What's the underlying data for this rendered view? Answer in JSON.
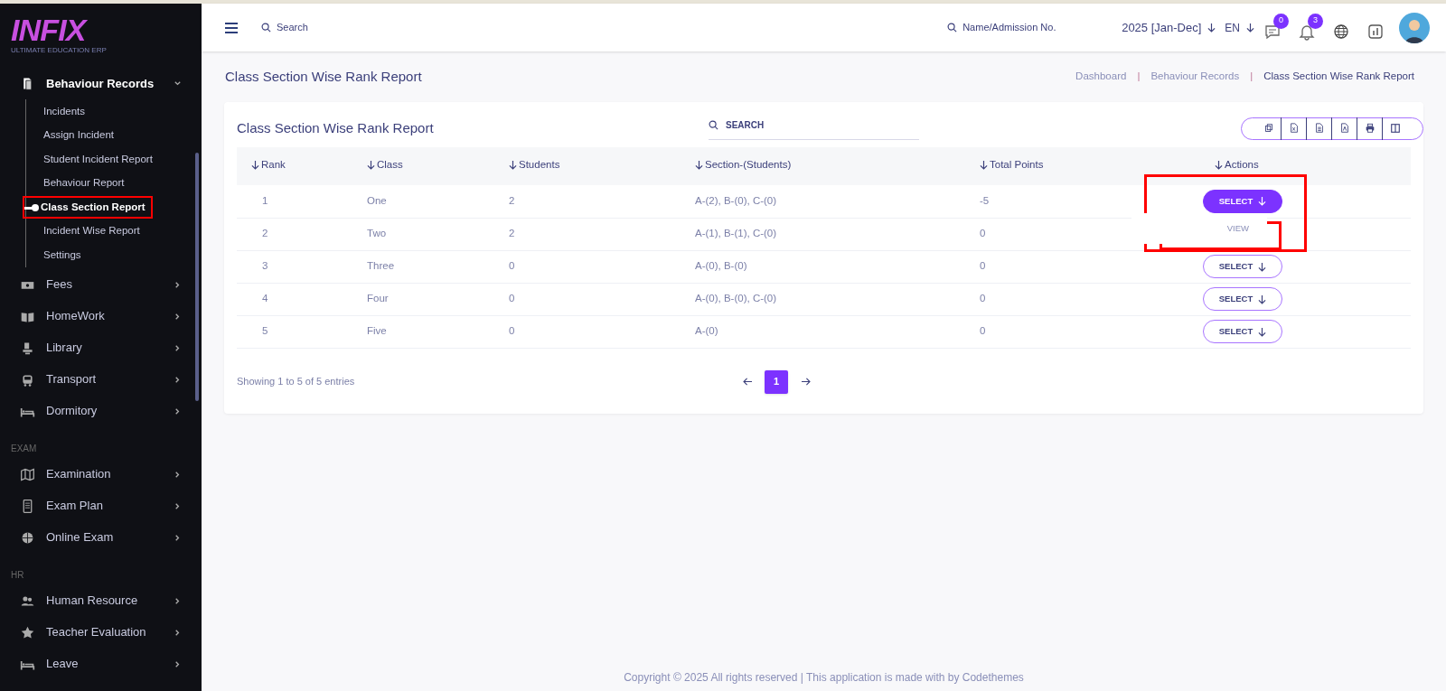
{
  "brand": {
    "logo": "INFIX",
    "tagline": "ULTIMATE EDUCATION ERP"
  },
  "sidebar": {
    "items": [
      {
        "kind": "group",
        "label": "Behaviour Records",
        "expanded": true,
        "children": [
          {
            "label": "Incidents",
            "selected": false
          },
          {
            "label": "Assign Incident",
            "selected": false
          },
          {
            "label": "Student Incident Report",
            "selected": false
          },
          {
            "label": "Behaviour Report",
            "selected": false
          },
          {
            "label": "Class Section Report",
            "selected": true
          },
          {
            "label": "Incident Wise Report",
            "selected": false
          },
          {
            "label": "Settings",
            "selected": false
          }
        ]
      },
      {
        "kind": "group",
        "label": "Fees",
        "expanded": false
      },
      {
        "kind": "group",
        "label": "HomeWork",
        "expanded": false
      },
      {
        "kind": "group",
        "label": "Library",
        "expanded": false
      },
      {
        "kind": "group",
        "label": "Transport",
        "expanded": false
      },
      {
        "kind": "group",
        "label": "Dormitory",
        "expanded": false
      },
      {
        "kind": "heading",
        "label": "EXAM"
      },
      {
        "kind": "group",
        "label": "Examination",
        "expanded": false
      },
      {
        "kind": "group",
        "label": "Exam Plan",
        "expanded": false
      },
      {
        "kind": "group",
        "label": "Online Exam",
        "expanded": false
      },
      {
        "kind": "heading",
        "label": "HR"
      },
      {
        "kind": "group",
        "label": "Human Resource",
        "expanded": false
      },
      {
        "kind": "group",
        "label": "Teacher Evaluation",
        "expanded": false
      },
      {
        "kind": "group",
        "label": "Leave",
        "expanded": false
      }
    ]
  },
  "topbar": {
    "search": {
      "placeholder": "Search"
    },
    "student_search": {
      "placeholder": "Name/Admission No."
    },
    "session": "2025 [Jan-Dec]",
    "language": "EN",
    "messages_count": "0",
    "notifications_count": "3"
  },
  "page": {
    "title": "Class Section Wise Rank Report",
    "breadcrumbs": [
      {
        "kind": "link",
        "label": "Dashboard"
      },
      {
        "kind": "separator",
        "label": "|"
      },
      {
        "kind": "link",
        "label": "Behaviour Records"
      },
      {
        "kind": "separator",
        "label": "|"
      },
      {
        "kind": "current",
        "label": "Class Section Wise Rank Report"
      }
    ]
  },
  "card": {
    "title": "Class Section Wise Rank Report",
    "search": {
      "placeholder": "SEARCH"
    }
  },
  "table": {
    "columns": [
      "Rank",
      "Class",
      "Students",
      "Section-(Students)",
      "Total Points",
      "Actions"
    ],
    "rows": [
      {
        "cells": [
          "1",
          "One",
          "2",
          "A-(2), B-(0), C-(0)",
          "-5"
        ],
        "action": "SELECT",
        "expanded": true,
        "menu": [
          "VIEW"
        ]
      },
      {
        "cells": [
          "2",
          "Two",
          "2",
          "A-(1), B-(1), C-(0)",
          "0"
        ]
      },
      {
        "cells": [
          "3",
          "Three",
          "0",
          "A-(0), B-(0)",
          "0"
        ],
        "action": "SELECT",
        "expanded": false
      },
      {
        "cells": [
          "4",
          "Four",
          "0",
          "A-(0), B-(0), C-(0)",
          "0"
        ],
        "action": "SELECT",
        "expanded": false
      },
      {
        "cells": [
          "5",
          "Five",
          "0",
          "A-(0)",
          "0"
        ],
        "action": "SELECT",
        "expanded": false
      }
    ]
  },
  "pagination": {
    "info": "Showing 1 to 5 of 5 entries",
    "pages": [
      {
        "label": "1",
        "selected": true
      }
    ]
  },
  "footer": "Copyright © 2025 All rights reserved | This application is made with by Codethemes"
}
